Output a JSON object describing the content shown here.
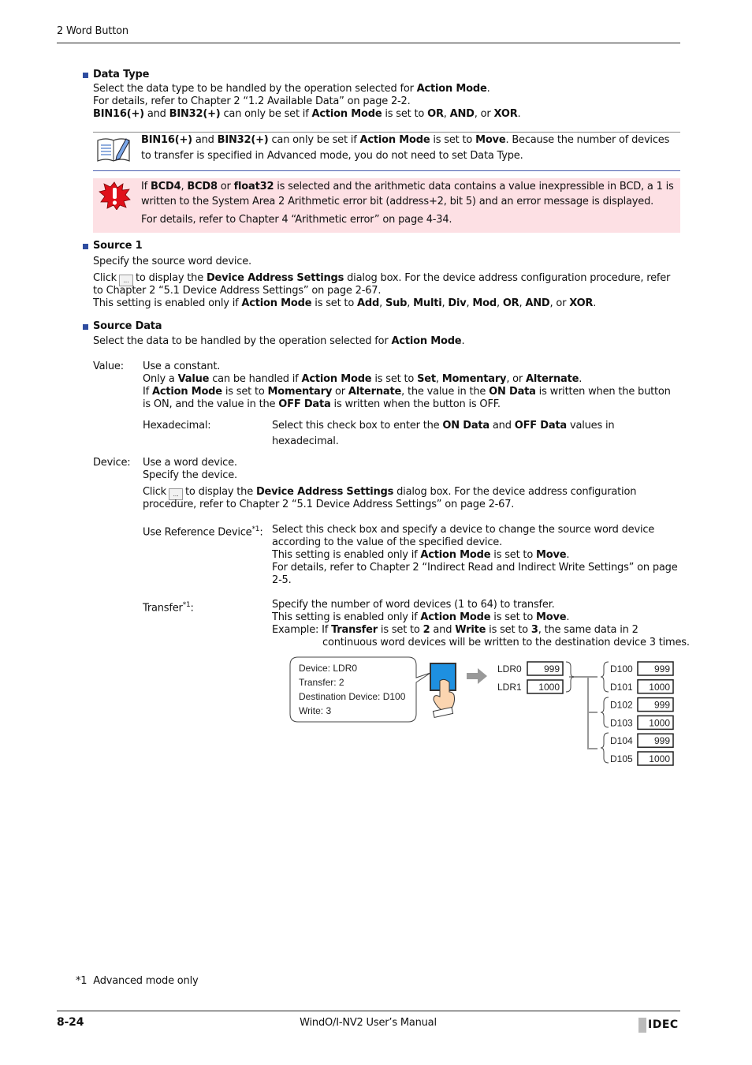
{
  "header": {
    "chapter": "2 Word Button"
  },
  "data_type": {
    "heading": "Data Type",
    "lines": [
      [
        {
          "t": "Select the data type to be handled by the operation selected for "
        },
        {
          "t": "Action Mode",
          "b": true
        },
        {
          "t": "."
        }
      ],
      [
        {
          "t": "For details, refer to Chapter 2 “1.2 Available Data” on page 2-2."
        }
      ],
      [
        {
          "t": "BIN16(+)",
          "b": true
        },
        {
          "t": " and "
        },
        {
          "t": "BIN32(+)",
          "b": true
        },
        {
          "t": " can only be set if "
        },
        {
          "t": "Action Mode",
          "b": true
        },
        {
          "t": " is set to "
        },
        {
          "t": "OR",
          "b": true
        },
        {
          "t": ", "
        },
        {
          "t": "AND",
          "b": true
        },
        {
          "t": ", or "
        },
        {
          "t": "XOR",
          "b": true
        },
        {
          "t": "."
        }
      ]
    ]
  },
  "note": {
    "icon": "note-pencil-icon",
    "lines": [
      [
        {
          "t": "BIN16(+)",
          "b": true
        },
        {
          "t": " and "
        },
        {
          "t": "BIN32(+)",
          "b": true
        },
        {
          "t": " can only be set if "
        },
        {
          "t": "Action Mode",
          "b": true
        },
        {
          "t": " is set to "
        },
        {
          "t": "Move",
          "b": true
        },
        {
          "t": ". Because the number of devices"
        }
      ],
      [
        {
          "t": "to transfer is specified in Advanced mode, you do not need to set Data Type."
        }
      ]
    ]
  },
  "caution": {
    "icon": "warning-exclamation-icon",
    "color": "#fde0e4",
    "lines": [
      [
        {
          "t": "If "
        },
        {
          "t": "BCD4",
          "b": true
        },
        {
          "t": ", "
        },
        {
          "t": "BCD8",
          "b": true
        },
        {
          "t": " or "
        },
        {
          "t": "float32",
          "b": true
        },
        {
          "t": " is selected and the arithmetic data contains a value inexpressible in BCD, a 1 is"
        }
      ],
      [
        {
          "t": "written to the System Area 2 Arithmetic error bit (address+2, bit 5) and an error message is displayed."
        }
      ],
      [
        {
          "t": "For details, refer to Chapter 4 “Arithmetic error” on page 4-34."
        }
      ]
    ]
  },
  "source1": {
    "heading": "Source 1",
    "lines": [
      [
        {
          "t": "Specify the source word device."
        }
      ],
      [
        {
          "t": "to display the "
        },
        {
          "t": "Device Address Settings",
          "b": true
        },
        {
          "t": " dialog box. For the device address configuration procedure, refer"
        }
      ],
      [
        {
          "t": "to Chapter 2 “5.1 Device Address Settings” on page 2-67."
        }
      ],
      [
        {
          "t": "This setting is enabled only if "
        },
        {
          "t": "Action Mode",
          "b": true
        },
        {
          "t": " is set to "
        },
        {
          "t": "Add",
          "b": true
        },
        {
          "t": ", "
        },
        {
          "t": "Sub",
          "b": true
        },
        {
          "t": ", "
        },
        {
          "t": "Multi",
          "b": true
        },
        {
          "t": ", "
        },
        {
          "t": "Div",
          "b": true
        },
        {
          "t": ", "
        },
        {
          "t": "Mod",
          "b": true
        },
        {
          "t": ", "
        },
        {
          "t": "OR",
          "b": true
        },
        {
          "t": ", "
        },
        {
          "t": "AND",
          "b": true
        },
        {
          "t": ", or "
        },
        {
          "t": "XOR",
          "b": true
        },
        {
          "t": "."
        }
      ]
    ],
    "click": "Click",
    "browse_button": "..."
  },
  "source_data": {
    "heading": "Source Data",
    "intro": [
      {
        "t": "Select the data to be handled by the operation selected for "
      },
      {
        "t": "Action Mode",
        "b": true
      },
      {
        "t": "."
      }
    ],
    "value": {
      "label": "Value:",
      "lines": [
        [
          {
            "t": "Use a constant."
          }
        ],
        [
          {
            "t": "Only a "
          },
          {
            "t": "Value",
            "b": true
          },
          {
            "t": " can be handled if "
          },
          {
            "t": "Action Mode",
            "b": true
          },
          {
            "t": " is set to "
          },
          {
            "t": "Set",
            "b": true
          },
          {
            "t": ", "
          },
          {
            "t": "Momentary",
            "b": true
          },
          {
            "t": ", or "
          },
          {
            "t": "Alternate",
            "b": true
          },
          {
            "t": "."
          }
        ],
        [
          {
            "t": "If "
          },
          {
            "t": "Action Mode",
            "b": true
          },
          {
            "t": " is set to "
          },
          {
            "t": "Momentary",
            "b": true
          },
          {
            "t": " or "
          },
          {
            "t": "Alternate",
            "b": true
          },
          {
            "t": ", the value in the "
          },
          {
            "t": "ON Data",
            "b": true
          },
          {
            "t": " is written when the button"
          }
        ],
        [
          {
            "t": "is ON, and the value in the "
          },
          {
            "t": "OFF Data",
            "b": true
          },
          {
            "t": " is written when the button is OFF."
          }
        ]
      ],
      "hex_label": "Hexadecimal:",
      "hex_lines": [
        [
          {
            "t": "Select this check box to enter the "
          },
          {
            "t": "ON Data",
            "b": true
          },
          {
            "t": " and "
          },
          {
            "t": "OFF Data",
            "b": true
          },
          {
            "t": " values in"
          }
        ],
        [
          {
            "t": "hexadecimal."
          }
        ]
      ]
    },
    "device": {
      "label": "Device:",
      "lines": [
        [
          {
            "t": "Use a word device."
          }
        ],
        [
          {
            "t": "Specify the device."
          }
        ],
        [
          {
            "t": "to display the "
          },
          {
            "t": "Device Address Settings",
            "b": true
          },
          {
            "t": " dialog box. For the device address configuration"
          }
        ],
        [
          {
            "t": "procedure, refer to Chapter 2 “5.1 Device Address Settings” on page 2-67."
          }
        ]
      ],
      "click": "Click",
      "browse_button": "...",
      "ref_label": "Use Reference Device",
      "ref_sup": "*1",
      "ref_colon": ":",
      "ref_lines": [
        [
          {
            "t": "Select this check box and specify a device to change the source word device"
          }
        ],
        [
          {
            "t": "according to the value of the specified device."
          }
        ],
        [
          {
            "t": "This setting is enabled only if "
          },
          {
            "t": "Action Mode",
            "b": true
          },
          {
            "t": " is set to "
          },
          {
            "t": "Move",
            "b": true
          },
          {
            "t": "."
          }
        ],
        [
          {
            "t": "For details, refer to Chapter 2 “Indirect Read and Indirect Write Settings” on page"
          }
        ],
        [
          {
            "t": "2-5."
          }
        ]
      ],
      "transfer_label": "Transfer",
      "transfer_sup": "*1",
      "transfer_colon": ":",
      "transfer_lines": [
        [
          {
            "t": "Specify the number of word devices (1 to 64) to transfer."
          }
        ],
        [
          {
            "t": "This setting is enabled only if "
          },
          {
            "t": "Action Mode",
            "b": true
          },
          {
            "t": " is set to "
          },
          {
            "t": "Move",
            "b": true
          },
          {
            "t": "."
          }
        ],
        [
          {
            "t": "Example: If "
          },
          {
            "t": "Transfer",
            "b": true
          },
          {
            "t": " is set to "
          },
          {
            "t": "2",
            "b": true
          },
          {
            "t": " and "
          },
          {
            "t": "Write",
            "b": true
          },
          {
            "t": " is set to "
          },
          {
            "t": "3",
            "b": true
          },
          {
            "t": ", the same data in 2"
          }
        ],
        [
          {
            "t": "continuous word devices will be written to the destination device 3 times."
          }
        ]
      ]
    }
  },
  "diagram": {
    "callout": [
      "Device: LDR0",
      "Transfer: 2",
      "Destination Device: D100",
      "Write: 3"
    ],
    "button_color": "#1e90e0",
    "source": [
      {
        "name": "LDR0",
        "value": "999"
      },
      {
        "name": "LDR1",
        "value": "1000"
      }
    ],
    "dest": [
      {
        "name": "D100",
        "value": "999"
      },
      {
        "name": "D101",
        "value": "1000"
      },
      {
        "name": "D102",
        "value": "999"
      },
      {
        "name": "D103",
        "value": "1000"
      },
      {
        "name": "D104",
        "value": "999"
      },
      {
        "name": "D105",
        "value": "1000"
      }
    ]
  },
  "footnote": {
    "mark": "*1",
    "text": "Advanced mode only"
  },
  "footer": {
    "page": "8-24",
    "title": "WindO/I-NV2 User’s Manual",
    "logo": "IDEC"
  }
}
